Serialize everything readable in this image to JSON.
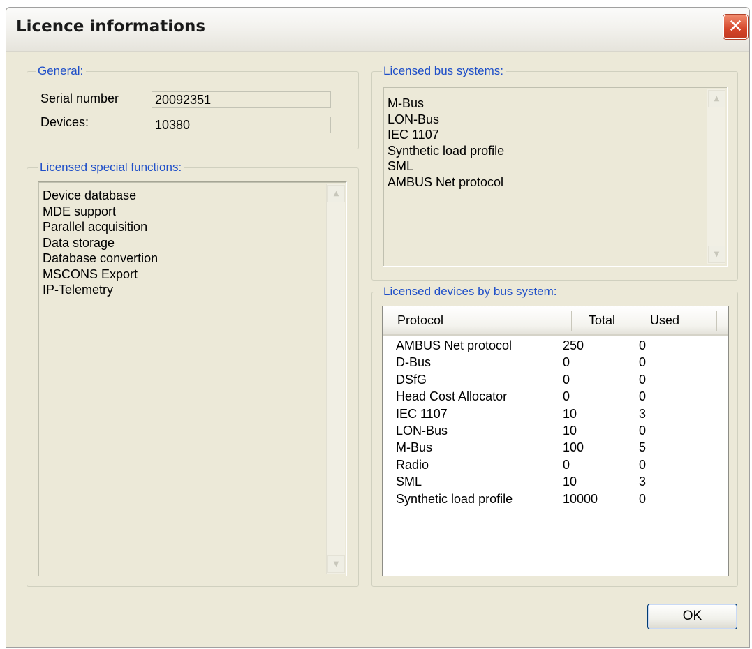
{
  "window": {
    "title": "Licence informations",
    "close_symbol": "✕"
  },
  "general": {
    "label": "General:",
    "serial_label": "Serial number",
    "serial_value": "20092351",
    "devices_label": "Devices:",
    "devices_value": "10380"
  },
  "special_functions": {
    "label": "Licensed special functions:",
    "items": [
      "Device database",
      "MDE support",
      "Parallel acquisition",
      "Data storage",
      "Database convertion",
      "MSCONS Export",
      "IP-Telemetry"
    ]
  },
  "bus_systems": {
    "label": "Licensed bus systems:",
    "items": [
      "M-Bus",
      "LON-Bus",
      "IEC 1107",
      "Synthetic load profile",
      "SML",
      "AMBUS Net protocol"
    ]
  },
  "devices_by_bus": {
    "label": "Licensed devices by bus system:",
    "columns": [
      "Protocol",
      "Total",
      "Used"
    ],
    "rows": [
      [
        "AMBUS Net protocol",
        "250",
        "0"
      ],
      [
        "D-Bus",
        "0",
        "0"
      ],
      [
        "DSfG",
        "0",
        "0"
      ],
      [
        "Head Cost Allocator",
        "0",
        "0"
      ],
      [
        "IEC 1107",
        "10",
        "3"
      ],
      [
        "LON-Bus",
        "10",
        "0"
      ],
      [
        "M-Bus",
        "100",
        "5"
      ],
      [
        "Radio",
        "0",
        "0"
      ],
      [
        "SML",
        "10",
        "3"
      ],
      [
        "Synthetic load profile",
        "10000",
        "0"
      ]
    ]
  },
  "buttons": {
    "ok_label": "OK"
  },
  "icons": {
    "close": "close-icon",
    "scroll_up": "scroll-up-arrow-icon",
    "scroll_down": "scroll-down-arrow-icon"
  }
}
